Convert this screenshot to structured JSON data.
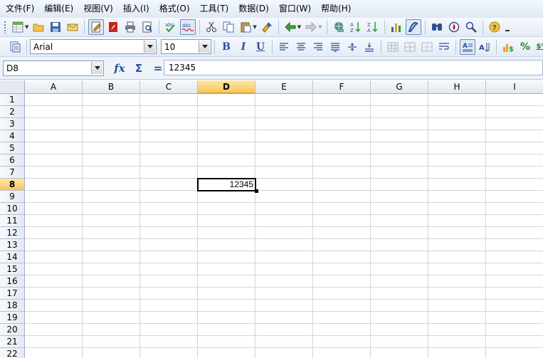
{
  "menu": [
    "文件(F)",
    "编辑(E)",
    "视图(V)",
    "插入(I)",
    "格式(O)",
    "工具(T)",
    "数据(D)",
    "窗口(W)",
    "帮助(H)"
  ],
  "toolbar1": {
    "icons": [
      "new-spreadsheet-icon",
      "open-folder-icon",
      "save-icon",
      "email-icon",
      "edit-file-icon",
      "export-pdf-icon",
      "print-icon",
      "print-preview-icon",
      "spellcheck-icon",
      "autospellcheck-icon",
      "cut-icon",
      "copy-icon",
      "paste-icon",
      "format-paintbrush-icon",
      "undo-icon",
      "redo-icon",
      "hyperlink-icon",
      "sort-ascending-icon",
      "sort-descending-icon",
      "chart-icon",
      "draw-functions-icon",
      "find-replace-icon",
      "navigator-icon",
      "zoom-icon",
      "help-icon"
    ]
  },
  "toolbar2": {
    "font_name": "Arial",
    "font_size": "10",
    "bold": "B",
    "italic": "I",
    "underline": "U",
    "currency": "%",
    "number_format": "$%"
  },
  "formula_bar": {
    "name_box": "D8",
    "function_wizard": "fx",
    "sum": "Σ",
    "equals": "=",
    "content": "12345"
  },
  "sheet": {
    "columns": [
      "A",
      "B",
      "C",
      "D",
      "E",
      "F",
      "G",
      "H",
      "I"
    ],
    "rows": [
      "1",
      "2",
      "3",
      "4",
      "5",
      "6",
      "7",
      "8",
      "9",
      "10",
      "11",
      "12",
      "13",
      "14",
      "15",
      "16",
      "17",
      "18",
      "19",
      "20",
      "21",
      "22"
    ],
    "selected_column": "D",
    "selected_row": "8",
    "active_cell_value": "12345"
  }
}
